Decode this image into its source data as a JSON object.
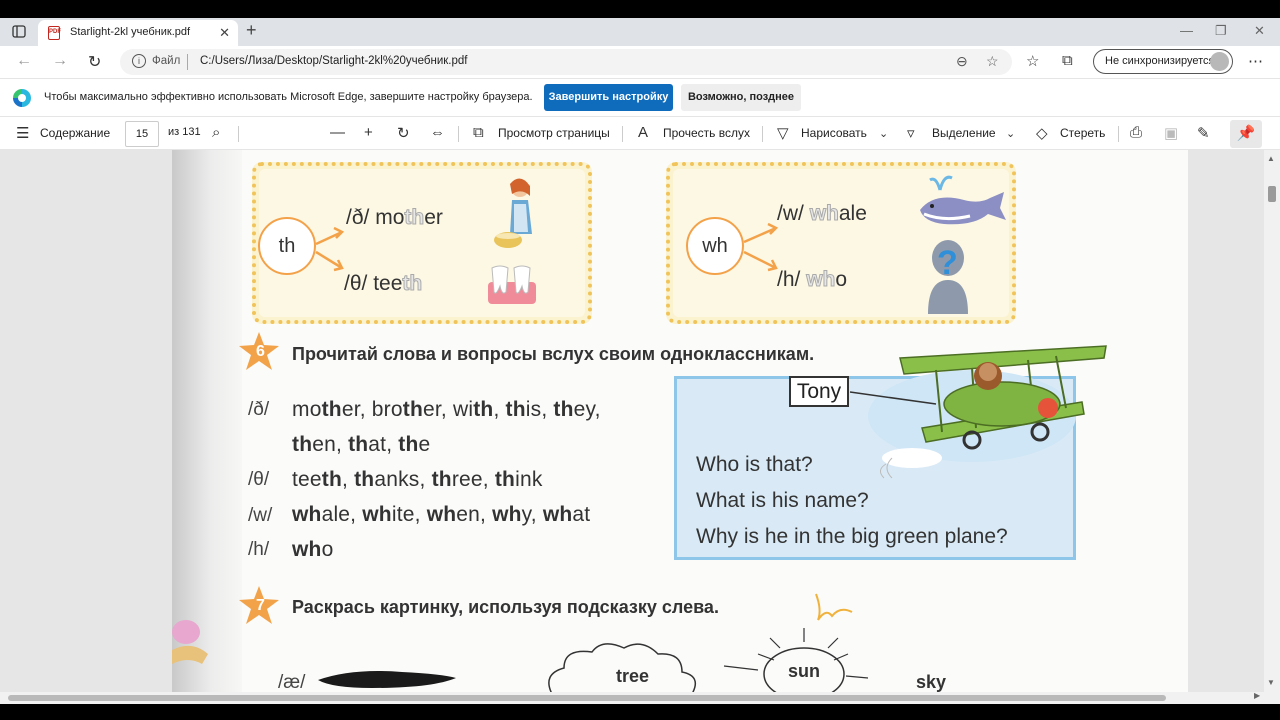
{
  "browser": {
    "tab_title": "Starlight-2kl учебник.pdf",
    "tab_close": "✕",
    "new_tab": "+",
    "address_scheme": "Файл",
    "address_url": "C:/Users/Лиза/Desktop/Starlight-2kl%20учебник.pdf",
    "profile_label": "Не синхронизируется"
  },
  "infobar": {
    "message": "Чтобы максимально эффективно использовать Microsoft Edge, завершите настройку браузера.",
    "primary_button": "Завершить настройку",
    "secondary_button": "Возможно, позднее"
  },
  "pdf_toolbar": {
    "contents": "Содержание",
    "page_number": "15",
    "page_total": "из 131",
    "page_view": "Просмотр страницы",
    "read_aloud": "Прочесть вслух",
    "draw": "Нарисовать",
    "highlight": "Выделение",
    "erase": "Стереть"
  },
  "textbook": {
    "box1": {
      "circle": "th",
      "line1_ipa": "/ð/",
      "line1_pre": "mo",
      "line1_ghost": "th",
      "line1_post": "er",
      "line2_ipa": "/θ/",
      "line2_pre": "tee",
      "line2_ghost": "th"
    },
    "box2": {
      "circle": "wh",
      "line1_ipa": "/w/",
      "line1_ghost": "wh",
      "line1_post": "ale",
      "line2_ipa": "/h/",
      "line2_ghost": "wh",
      "line2_post": "o"
    },
    "exercise6": {
      "number": "6",
      "title": "Прочитай слова и вопросы вслух своим одноклассникам.",
      "rows": [
        {
          "ipa": "/ð/",
          "parts": [
            [
              "mo",
              ""
            ],
            [
              "th",
              "b"
            ],
            [
              "er, bro",
              ""
            ],
            [
              "th",
              "b"
            ],
            [
              "er, wi",
              ""
            ],
            [
              "th",
              "b"
            ],
            [
              ", ",
              ""
            ],
            [
              "th",
              "b"
            ],
            [
              "is, ",
              ""
            ],
            [
              "th",
              "b"
            ],
            [
              "ey,",
              ""
            ]
          ]
        },
        {
          "ipa": "",
          "parts": [
            [
              "th",
              "b"
            ],
            [
              "en, ",
              ""
            ],
            [
              "th",
              "b"
            ],
            [
              "at, ",
              ""
            ],
            [
              "th",
              "b"
            ],
            [
              "e",
              ""
            ]
          ]
        },
        {
          "ipa": "/θ/",
          "parts": [
            [
              "tee",
              ""
            ],
            [
              "th",
              "b"
            ],
            [
              ", ",
              ""
            ],
            [
              "th",
              "b"
            ],
            [
              "anks, ",
              ""
            ],
            [
              "th",
              "b"
            ],
            [
              "ree, ",
              ""
            ],
            [
              "th",
              "b"
            ],
            [
              "ink",
              ""
            ]
          ]
        },
        {
          "ipa": "/w/",
          "parts": [
            [
              "wh",
              "b"
            ],
            [
              "ale, ",
              ""
            ],
            [
              "wh",
              "b"
            ],
            [
              "ite, ",
              ""
            ],
            [
              "wh",
              "b"
            ],
            [
              "en, ",
              ""
            ],
            [
              "wh",
              "b"
            ],
            [
              "y, ",
              ""
            ],
            [
              "wh",
              "b"
            ],
            [
              "at",
              ""
            ]
          ]
        },
        {
          "ipa": "/h/",
          "parts": [
            [
              "wh",
              "b"
            ],
            [
              "o",
              ""
            ]
          ]
        }
      ],
      "tony": "Tony",
      "questions": [
        "Who is that?",
        "What is his name?",
        "Why is he in the big green plane?"
      ]
    },
    "exercise7": {
      "number": "7",
      "title": "Раскрась картинку, используя подсказку слева.",
      "ipa": "/æ/",
      "labels": [
        "tree",
        "sun",
        "sky"
      ]
    }
  }
}
